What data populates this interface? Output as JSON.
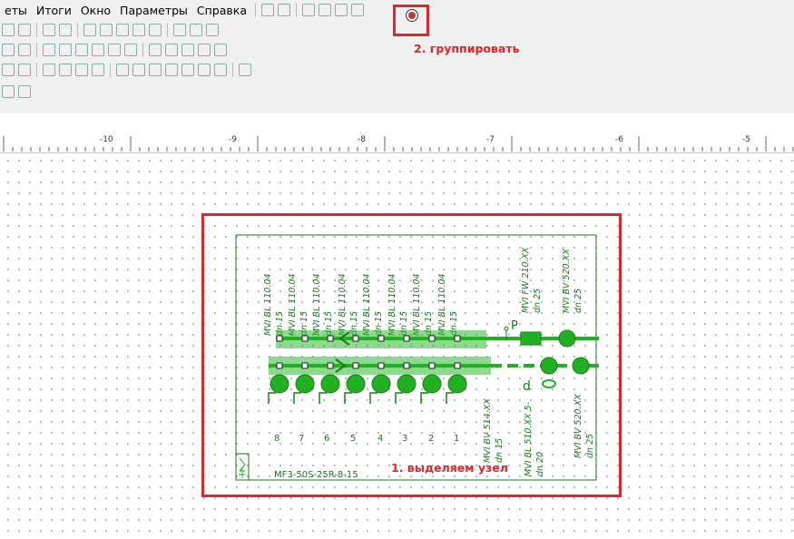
{
  "menu": [
    "еты",
    "Итоги",
    "Окно",
    "Параметры",
    "Справка"
  ],
  "ruler": {
    "ticks": [
      "-10",
      "-9",
      "-8",
      "-7",
      "-6",
      "-5"
    ]
  },
  "annotations": {
    "group": "2. группировать",
    "select": "1. выделяем узел"
  },
  "diagram": {
    "top_labels": [
      {
        "name": "MVI BL 110.04",
        "dn": "dn 15"
      },
      {
        "name": "MVI BL 110.04",
        "dn": "dn 15"
      },
      {
        "name": "MVI BL 110.04",
        "dn": "dn 15"
      },
      {
        "name": "MVI BL 110.04",
        "dn": "dn 15"
      },
      {
        "name": "MVI BL 110.04",
        "dn": "dn 15"
      },
      {
        "name": "MVI BL 110.04",
        "dn": "dn 15"
      },
      {
        "name": "MVI BL 110.04",
        "dn": "dn 15"
      },
      {
        "name": "MVI BL 110.04",
        "dn": "dn 15"
      }
    ],
    "top_right_labels": [
      {
        "name": "MVI FW 210.XX",
        "dn": "dn 25"
      },
      {
        "name": "MVI BV 520.XX",
        "dn": "dn 25"
      }
    ],
    "bottom_labels": [
      {
        "name": "MVI BV 514.XX",
        "dn": "dn 15"
      },
      {
        "name": "MVI BL 510.XX 5-",
        "dn": "dn 20"
      },
      {
        "name": "MVI BV 520.XX",
        "dn": "dn 25"
      }
    ],
    "numbers": [
      "8",
      "7",
      "6",
      "5",
      "4",
      "3",
      "2",
      "1"
    ],
    "p_label": "P",
    "d_label": "d",
    "model": "MF3-50S-25R-8-15",
    "colors": {
      "green": "#1fb11f",
      "dark_green": "#1a7a1a",
      "red": "#e3242b"
    }
  }
}
